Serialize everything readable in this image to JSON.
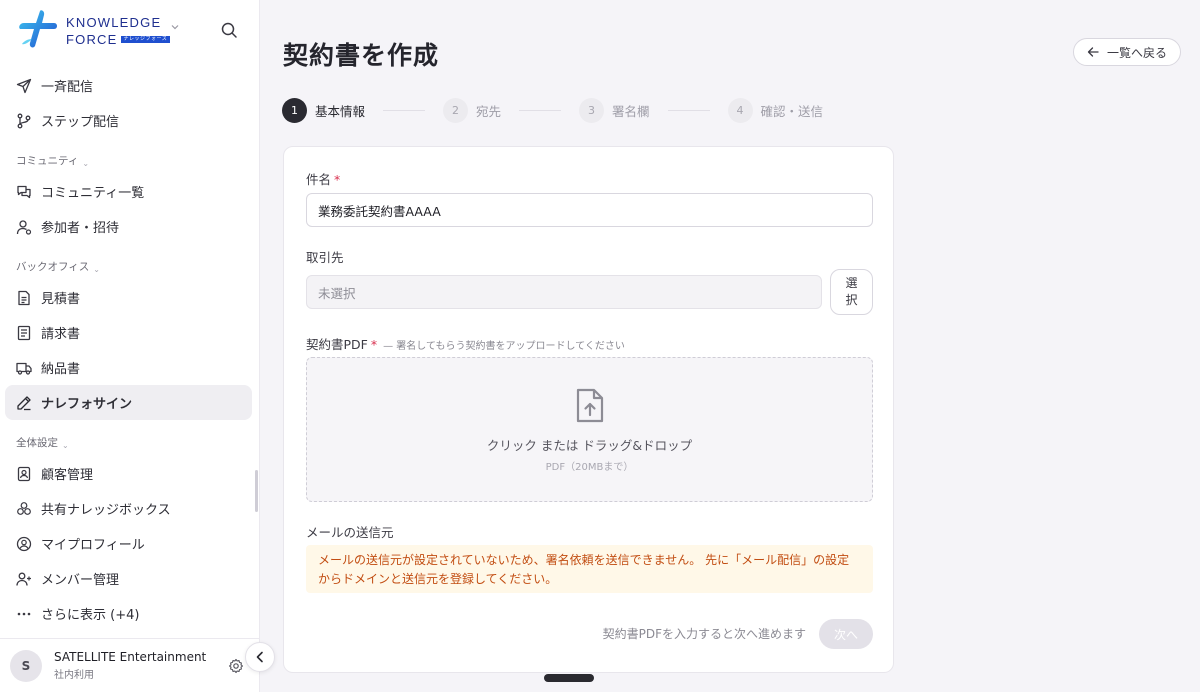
{
  "brand": {
    "line1": "KNOWLEDGE",
    "line2": "FORCE",
    "tag": "ナレッジフォース"
  },
  "sidebar": {
    "items_top": [
      {
        "label": "一斉配信",
        "icon": "send-icon"
      },
      {
        "label": "ステップ配信",
        "icon": "branch-icon"
      }
    ],
    "section_community": "コミュニティ",
    "items_community": [
      {
        "label": "コミュニティ一覧",
        "icon": "chat-bubbles-icon"
      },
      {
        "label": "参加者・招待",
        "icon": "user-icon"
      }
    ],
    "section_backoffice": "バックオフィス",
    "items_backoffice": [
      {
        "label": "見積書",
        "icon": "document-icon"
      },
      {
        "label": "請求書",
        "icon": "invoice-icon"
      },
      {
        "label": "納品書",
        "icon": "truck-icon"
      },
      {
        "label": "ナレフォサイン",
        "icon": "pen-icon",
        "active": true
      }
    ],
    "section_settings": "全体設定",
    "items_settings": [
      {
        "label": "顧客管理",
        "icon": "contact-book-icon"
      },
      {
        "label": "共有ナレッジボックス",
        "icon": "boxes-icon"
      },
      {
        "label": "マイプロフィール",
        "icon": "profile-circle-icon"
      },
      {
        "label": "メンバー管理",
        "icon": "members-icon"
      },
      {
        "label": "さらに表示 (+4)",
        "icon": "more-dots-icon"
      }
    ],
    "account": {
      "avatar_letter": "S",
      "name": "SATELLITE Entertainment",
      "sub": "社内利用"
    }
  },
  "page": {
    "title": "契約書を作成",
    "back_label": "一覧へ戻る"
  },
  "stepper": [
    {
      "num": "1",
      "label": "基本情報",
      "active": true
    },
    {
      "num": "2",
      "label": "宛先",
      "active": false
    },
    {
      "num": "3",
      "label": "署名欄",
      "active": false
    },
    {
      "num": "4",
      "label": "確認・送信",
      "active": false
    }
  ],
  "form": {
    "subject_label": "件名",
    "required_mark": "*",
    "subject_value": "業務委託契約書AAAA",
    "client_label": "取引先",
    "client_placeholder": "未選択",
    "select_button": "選択",
    "pdf_label": "契約書PDF",
    "pdf_hint": "— 署名してもらう契約書をアップロードしてください",
    "dropzone_main": "クリック または ドラッグ&ドロップ",
    "dropzone_sub": "PDF（20MBまで）",
    "sender_label": "メールの送信元",
    "warning": "メールの送信元が設定されていないため、署名依頼を送信できません。 先に「メール配信」の設定からドメインと送信元を登録してください。",
    "footer_hint": "契約書PDFを入力すると次へ進めます",
    "next_button": "次へ"
  },
  "colors": {
    "accent_dark": "#2a2a31",
    "warning_text": "#c24d12",
    "warning_bg": "#fff8e8",
    "required": "#d9304f",
    "brand_blue": "#1f4fcf"
  }
}
